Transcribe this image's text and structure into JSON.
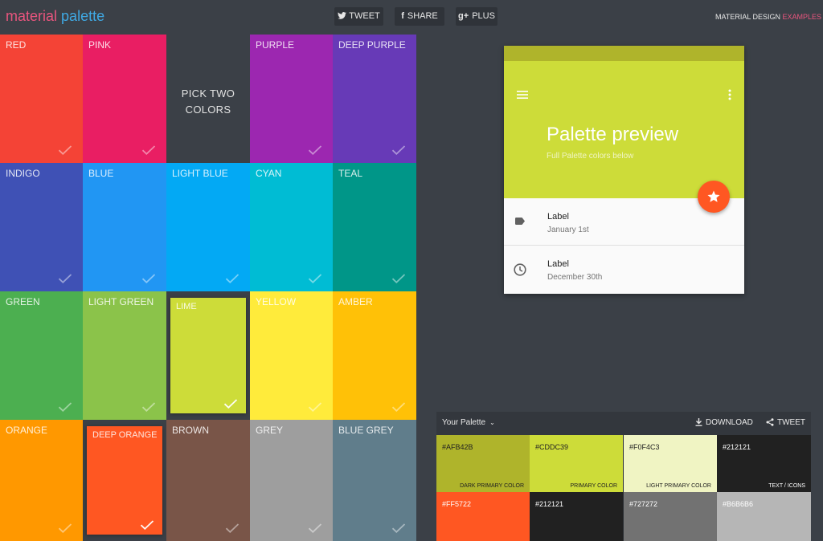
{
  "header": {
    "logo_word1": "material",
    "logo_word2": "palette",
    "buttons": [
      {
        "icon": "twitter-icon",
        "glyph": "🐦",
        "label": "TWEET"
      },
      {
        "icon": "facebook-icon",
        "glyph": "f",
        "label": "SHARE"
      },
      {
        "icon": "google-plus-icon",
        "glyph": "g+",
        "label": "PLUS"
      }
    ],
    "tagline_main": "MATERIAL DESIGN ",
    "tagline_accent": "EXAMPLES"
  },
  "grid": {
    "pick_line1": "PICK TWO",
    "pick_line2": "COLORS",
    "colors": [
      {
        "name": "RED",
        "color": "#f44336"
      },
      {
        "name": "PINK",
        "color": "#e91e63"
      },
      {
        "name": "",
        "color": "#3b4047"
      },
      {
        "name": "PURPLE",
        "color": "#9c27b0"
      },
      {
        "name": "DEEP PURPLE",
        "color": "#673ab7"
      },
      {
        "name": "INDIGO",
        "color": "#3f51b5"
      },
      {
        "name": "BLUE",
        "color": "#2196f3"
      },
      {
        "name": "LIGHT BLUE",
        "color": "#03a9f4"
      },
      {
        "name": "CYAN",
        "color": "#00bcd4"
      },
      {
        "name": "TEAL",
        "color": "#009688"
      },
      {
        "name": "GREEN",
        "color": "#4caf50"
      },
      {
        "name": "LIGHT GREEN",
        "color": "#8bc34a"
      },
      {
        "name": "LIME",
        "color": "#cddc39",
        "selected": true
      },
      {
        "name": "YELLOW",
        "color": "#ffeb3b"
      },
      {
        "name": "AMBER",
        "color": "#ffc107"
      },
      {
        "name": "ORANGE",
        "color": "#ff9800"
      },
      {
        "name": "DEEP ORANGE",
        "color": "#ff5722",
        "selected": true
      },
      {
        "name": "BROWN",
        "color": "#795548"
      },
      {
        "name": "GREY",
        "color": "#9e9e9e"
      },
      {
        "name": "BLUE GREY",
        "color": "#607d8b"
      }
    ]
  },
  "preview": {
    "status_color": "#afb42b",
    "appbar_color": "#cddc39",
    "accent_color": "#ff5722",
    "title": "Palette preview",
    "subtitle": "Full Palette colors below",
    "rows": [
      {
        "icon": "label-tag-icon",
        "label": "Label",
        "sub": "January 1st"
      },
      {
        "icon": "clock-icon",
        "label": "Label",
        "sub": "December 30th"
      }
    ]
  },
  "palette": {
    "title": "Your Palette",
    "download_label": "DOWNLOAD",
    "tweet_label": "TWEET",
    "swatches": [
      {
        "hex": "#AFB42B",
        "role": "DARK PRIMARY COLOR",
        "bg": "#afb42b",
        "fg": "#212121"
      },
      {
        "hex": "#CDDC39",
        "role": "PRIMARY COLOR",
        "bg": "#cddc39",
        "fg": "#212121"
      },
      {
        "hex": "#F0F4C3",
        "role": "LIGHT PRIMARY COLOR",
        "bg": "#f0f4c3",
        "fg": "#212121"
      },
      {
        "hex": "#212121",
        "role": "TEXT / ICONS",
        "bg": "#212121",
        "fg": "#ffffff"
      },
      {
        "hex": "#FF5722",
        "role": "",
        "bg": "#ff5722",
        "fg": "#ffffff"
      },
      {
        "hex": "#212121",
        "role": "",
        "bg": "#212121",
        "fg": "#ffffff"
      },
      {
        "hex": "#727272",
        "role": "",
        "bg": "#727272",
        "fg": "#ffffff"
      },
      {
        "hex": "#B6B6B6",
        "role": "",
        "bg": "#b6b6b6",
        "fg": "#ffffff"
      }
    ]
  }
}
